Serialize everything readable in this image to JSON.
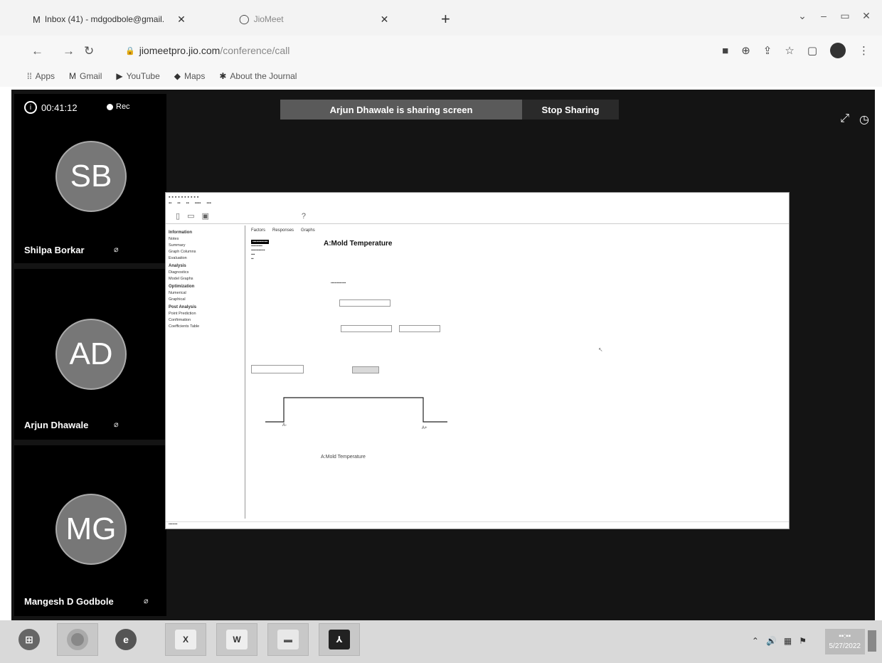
{
  "browser": {
    "tabs": [
      {
        "label": "Inbox (41) - mdgodbole@gmail.",
        "icon": "gmail-icon"
      },
      {
        "label": "JioMeet",
        "icon": "jiomeet-icon"
      }
    ],
    "url_host": "jiomeetpro.jio.com",
    "url_path": "/conference/call",
    "bookmarks": [
      {
        "label": "Apps",
        "icon": "apps-grid-icon"
      },
      {
        "label": "Gmail",
        "icon": "gmail-icon"
      },
      {
        "label": "YouTube",
        "icon": "youtube-icon"
      },
      {
        "label": "Maps",
        "icon": "maps-icon"
      },
      {
        "label": "About the Journal",
        "icon": "journal-icon"
      }
    ]
  },
  "meeting": {
    "elapsed": "00:41:12",
    "recording_label": "Rec",
    "share_message": "Arjun Dhawale is sharing screen",
    "stop_sharing_label": "Stop Sharing",
    "participants": [
      {
        "initials": "SB",
        "name": "Shilpa Borkar"
      },
      {
        "initials": "AD",
        "name": "Arjun Dhawale"
      },
      {
        "initials": "MG",
        "name": "Mangesh D Godbole"
      }
    ]
  },
  "shared_app": {
    "heading": "A:Mold Temperature",
    "tabs": [
      "Factors",
      "Responses",
      "Graphs"
    ],
    "sections": [
      "Information",
      "Analysis",
      "Optimization",
      "Post Analysis"
    ],
    "items": [
      "Notes",
      "Summary",
      "Graph Columns",
      "Evaluation",
      "Diagnostics",
      "Model Graphs",
      "Numerical",
      "Graphical",
      "Point Prediction",
      "Confirmation",
      "Coefficients Table"
    ],
    "axis_label": "A:Mold Temperature",
    "low_label": "A-",
    "high_label": "A+"
  },
  "taskbar": {
    "date": "5/27/2022",
    "apps": [
      {
        "icon": "chrome-icon"
      },
      {
        "icon": "chrome-active-icon"
      },
      {
        "icon": "edge-icon"
      },
      {
        "icon": "excel-icon"
      },
      {
        "icon": "word-icon"
      },
      {
        "icon": "folder-icon"
      },
      {
        "icon": "acrobat-icon"
      }
    ]
  }
}
